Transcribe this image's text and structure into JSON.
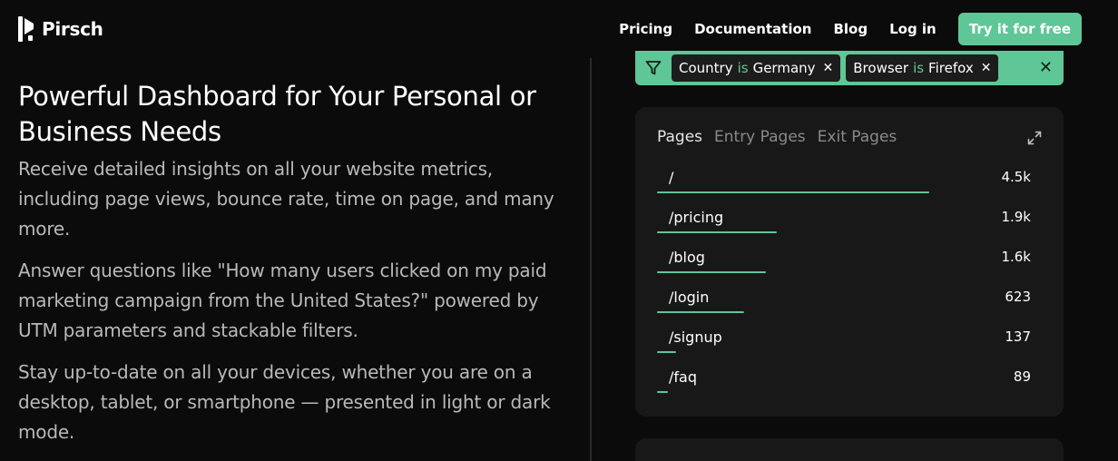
{
  "header": {
    "logo_text": "Pirsch",
    "nav": [
      "Pricing",
      "Documentation",
      "Blog",
      "Log in"
    ],
    "cta_label": "Try it for free"
  },
  "hero": {
    "title": "Powerful Dashboard for Your Personal or Business Needs",
    "paragraphs": [
      "Receive detailed insights on all your website metrics, including page views, bounce rate, time on page, and many more.",
      "Answer questions like \"How many users clicked on my paid marketing campaign from the United States?\" powered by UTM parameters and stackable filters.",
      "Stay up-to-date on all your devices, whether you are on a desktop, tablet, or smartphone — presented in light or dark mode."
    ]
  },
  "filters": [
    {
      "field": "Country",
      "op": "is",
      "value": "Germany",
      "remove": "✕"
    },
    {
      "field": "Browser",
      "op": "is",
      "value": "Firefox",
      "remove": "✕"
    }
  ],
  "filter_close": "✕",
  "card": {
    "tabs": [
      "Pages",
      "Entry Pages",
      "Exit Pages"
    ],
    "rows": [
      {
        "path": "/",
        "value": "4.5k",
        "fraction": 1.0
      },
      {
        "path": "/pricing",
        "value": "1.9k",
        "fraction": 0.44
      },
      {
        "path": "/blog",
        "value": "1.6k",
        "fraction": 0.4
      },
      {
        "path": "/login",
        "value": "623",
        "fraction": 0.32
      },
      {
        "path": "/signup",
        "value": "137",
        "fraction": 0.07
      },
      {
        "path": "/faq",
        "value": "89",
        "fraction": 0.04
      }
    ]
  },
  "colors": {
    "accent": "#5fc797",
    "background": "#0b0b0b",
    "card": "#181818"
  },
  "icons": [
    "pirsch-logo-icon",
    "filter-icon",
    "close-icon",
    "expand-icon"
  ]
}
